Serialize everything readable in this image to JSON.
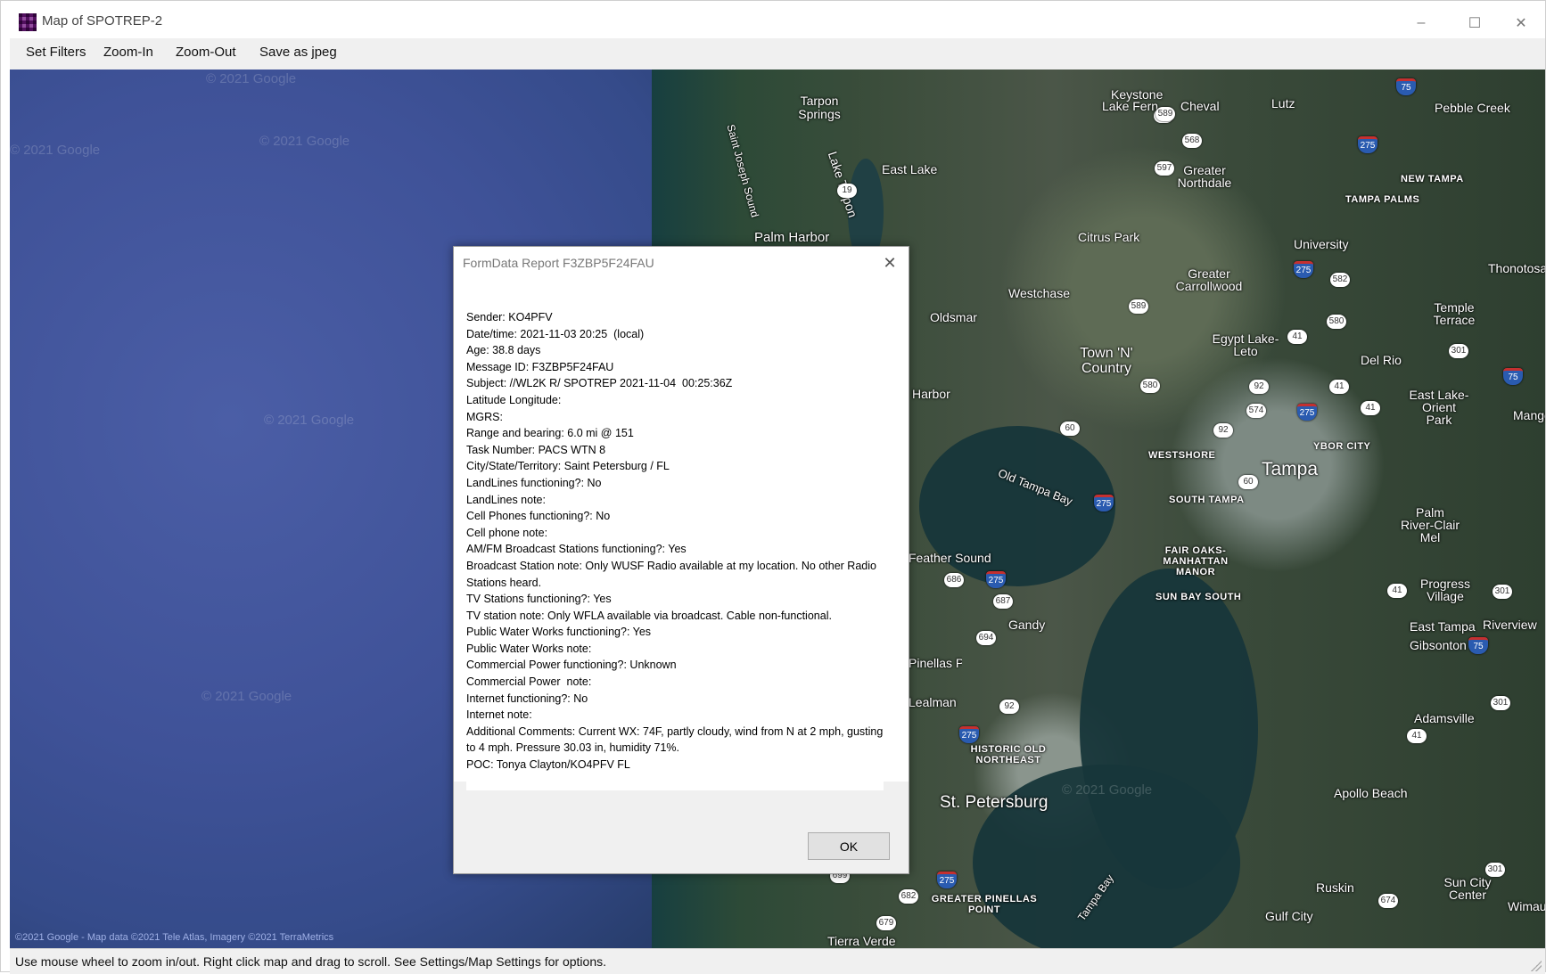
{
  "window": {
    "title": "Map of SPOTREP-2",
    "minimize": "–",
    "maximize": "☐",
    "close": "✕"
  },
  "menu": {
    "items": [
      "Set Filters",
      "Zoom-In",
      "Zoom-Out",
      "Save as jpeg"
    ]
  },
  "map": {
    "labels": [
      "Keystone",
      "Lake Fern",
      "Cheval",
      "Lutz",
      "Pebble Creek",
      "Tarpon Springs",
      "Lake Tarpon",
      "Saint Joseph Sound",
      "East Lake",
      "Greater Northdale",
      "NEW TAMPA",
      "TAMPA PALMS",
      "Palm Harbor",
      "Citrus Park",
      "University",
      "Thonotosassa",
      "Westchase",
      "Greater Carrollwood",
      "Oldsmar",
      "Temple Terrace",
      "Town 'N' Country",
      "Egypt Lake-Leto",
      "Del Rio",
      "Harbor",
      "East Lake-Orient Park",
      "Mango",
      "WESTSHORE",
      "YBOR CITY",
      "Tampa",
      "Old Tampa Bay",
      "SOUTH TAMPA",
      "Palm River-Clair Mel",
      "Feather Sound",
      "FAIR OAKS-MANHATTAN MANOR",
      "SUN BAY SOUTH",
      "Progress Village",
      "Gandy",
      "East Tampa",
      "Riverview",
      "Gibsonton",
      "Pinellas Park",
      "Lealman",
      "Adamsville",
      "HISTORIC OLD NORTHEAST",
      "St. Petersburg",
      "Apollo Beach",
      "GREATER PINELLAS POINT",
      "Tampa Bay",
      "Ruskin",
      "Sun City Center",
      "Gulf City",
      "Wimauma",
      "Tierra Verde"
    ],
    "watermark": "© 2021 Google",
    "attribution": "©2021 Google - Map data ©2021 Tele Atlas, Imagery ©2021 TerraMetrics"
  },
  "status": {
    "text": "Use mouse wheel to zoom in/out.  Right click map and drag to scroll.  See Settings/Map Settings for options."
  },
  "dialog": {
    "title": "FormData Report F3ZBP5F24FAU",
    "close": "✕",
    "lines": [
      "Sender: KO4PFV",
      "Date/time: 2021-11-03 20:25  (local)",
      "Age: 38.8 days",
      "Message ID: F3ZBP5F24FAU",
      "Subject: //WL2K R/ SPOTREP 2021-11-04  00:25:36Z",
      "Latitude Longitude:",
      "MGRS:",
      "Range and bearing: 6.0 mi @ 151",
      "Task Number: PACS WTN 8",
      "City/State/Territory: Saint Petersburg / FL",
      "LandLines functioning?: No",
      "LandLines note:",
      "Cell Phones functioning?: No",
      "Cell phone note:",
      "AM/FM Broadcast Stations functioning?: Yes",
      "Broadcast Station note: Only WUSF Radio available at my location. No other Radio Stations heard.",
      "TV Stations functioning?: Yes",
      "TV station note: Only WFLA available via broadcast. Cable non-functional.",
      "Public Water Works functioning?: Yes",
      "Public Water Works note:",
      "Commercial Power functioning?: Unknown",
      "Commercial Power  note:",
      "Internet functioning?: No",
      "Internet note:",
      "Additional Comments: Current WX: 74F, partly cloudy, wind from N at 2 mph, gusting to 4 mph. Pressure 30.03 in, humidity 71%.",
      "POC: Tonya Clayton/KO4PFV FL"
    ],
    "ok_label": "OK"
  }
}
